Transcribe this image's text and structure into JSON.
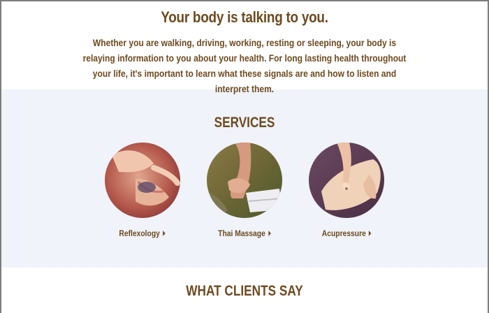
{
  "intro": {
    "heading": "Your body is talking to you.",
    "paragraph": "Whether you are walking, driving, working, resting or sleeping, your body is relaying information to you about your health. For long lasting health throughout your life, it's important to learn what these signals are and how to listen and interpret them."
  },
  "services": {
    "heading": "SERVICES",
    "items": [
      {
        "label": "Reflexology",
        "icon": "caret-right-icon"
      },
      {
        "label": "Thai Massage",
        "icon": "caret-right-icon"
      },
      {
        "label": "Acupressure",
        "icon": "caret-right-icon"
      }
    ]
  },
  "clients": {
    "heading": "WHAT CLIENTS SAY"
  },
  "colors": {
    "text": "#6e4a1f",
    "services_bg": "#f0f3fa",
    "border": "#7d7d7d"
  }
}
